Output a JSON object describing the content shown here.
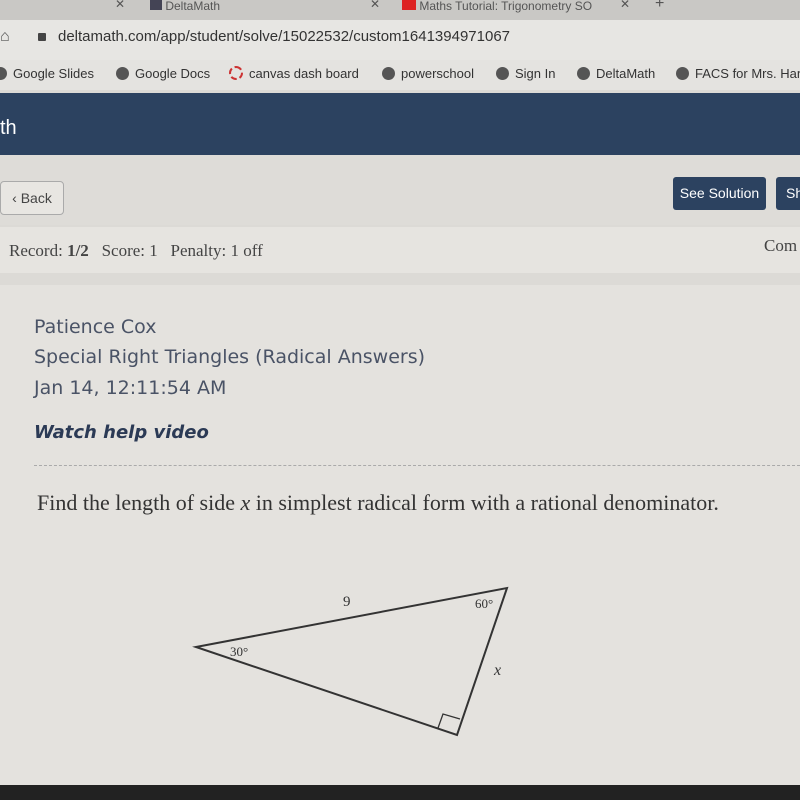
{
  "browser": {
    "tabs": [
      {
        "label": "DeltaMath"
      },
      {
        "label": "Maths Tutorial: Trigonometry SO"
      }
    ],
    "url": "deltamath.com/app/student/solve/15022532/custom1641394971067",
    "bookmarks": [
      {
        "label": "Google Slides"
      },
      {
        "label": "Google Docs"
      },
      {
        "label": "canvas dash board"
      },
      {
        "label": "powerschool"
      },
      {
        "label": "Sign In"
      },
      {
        "label": "DeltaMath"
      },
      {
        "label": "FACS for Mrs. Han"
      }
    ]
  },
  "header": {
    "brand": "th"
  },
  "toolbar": {
    "back": "Back",
    "see_solution": "See Solution",
    "show": "Sh"
  },
  "record": {
    "record_label": "Record:",
    "record_value": "1/2",
    "score": "Score: 1",
    "penalty": "Penalty: 1 off",
    "right": "Com"
  },
  "problem": {
    "student": "Patience Cox",
    "topic": "Special Right Triangles (Radical Answers)",
    "date": "Jan 14, 12:11:54 AM",
    "help": "Watch help video",
    "question_before": "Find the length of side ",
    "question_var": "x",
    "question_after": " in simplest radical form with a rational denominator.",
    "figure": {
      "hypotenuse": "9",
      "angle_a": "30°",
      "angle_b": "60°",
      "side": "x"
    }
  },
  "colors": {
    "navy": "#2c4260"
  }
}
